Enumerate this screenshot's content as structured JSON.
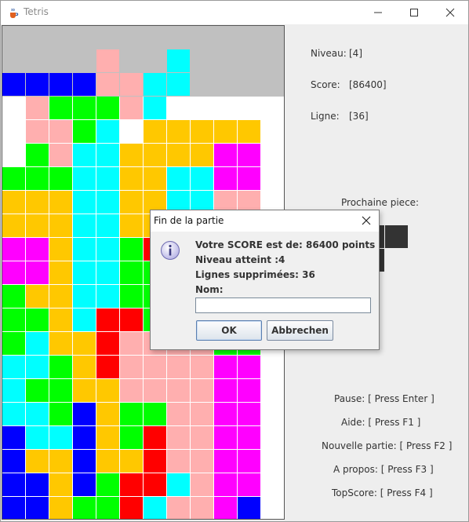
{
  "window": {
    "title": "Tetris",
    "icon": "java-cup-icon"
  },
  "titlebar_buttons": [
    "minimize-icon",
    "maximize-icon",
    "close-icon"
  ],
  "colors": {
    "B": "#0000ff",
    "P": "#ffafaf",
    "G": "#00ff00",
    "C": "#00ffff",
    "Y": "#ffc800",
    "M": "#ff00ff",
    "R": "#ff0000",
    "K": "#333333",
    "board_bg": "#ffffff",
    "board_top_bg": "#c0c0c0"
  },
  "board": {
    "columns": 12,
    "rows": 21,
    "cells": [
      "............",
      "....P..C....",
      "BBBBPPCC....",
      ".PGGGPC.....",
      ".PPGC.YYYYY.",
      ".GPCCYYYYMM.",
      "GGGCCYYCCMM.",
      "YYYCCYYCCPP.",
      "YYYCCYYCYPP.",
      "MMYCCGRYYPP.",
      "MMYCCGGYYPP.",
      "GYYCCGGPPPP.",
      "GGYCRRGPPGG.",
      "GCYYRPPPPGG.",
      "CCGYRPPPPMM.",
      "CGGYYPPPPMM.",
      "CCGBYGGPPMM.",
      "BCCBYGRPPMM.",
      "BYYBYYRPPMM.",
      "BBYBGRRCPMM.",
      "BBYGGRCPPMB"
    ]
  },
  "stats": {
    "level_label": "Niveau:",
    "level_value": "[4]",
    "score_label": "Score:",
    "score_value": "[86400]",
    "lines_label": "Ligne:",
    "lines_value": "[36]"
  },
  "next_piece": {
    "label": "Prochaine piece:",
    "color": "#333333",
    "cells": [
      [
        0,
        0
      ],
      [
        1,
        0
      ],
      [
        0,
        1
      ]
    ]
  },
  "shortcuts": {
    "pause": "Pause: [ Press Enter ]",
    "help": "Aide: [ Press F1 ]",
    "new_game": "Nouvelle partie: [ Press F2 ]",
    "about": "A propos: [ Press F3 ]",
    "topscore": "TopScore: [ Press F4 ]"
  },
  "dialog": {
    "title": "Fin de la partie",
    "icon": "info-icon",
    "score_line": "Votre SCORE est de: 86400 points",
    "level_line": "Niveau atteint :4",
    "lines_line": "Lignes supprimées: 36",
    "name_label": "Nom:",
    "name_value": "",
    "ok_label": "OK",
    "cancel_label": "Abbrechen"
  }
}
